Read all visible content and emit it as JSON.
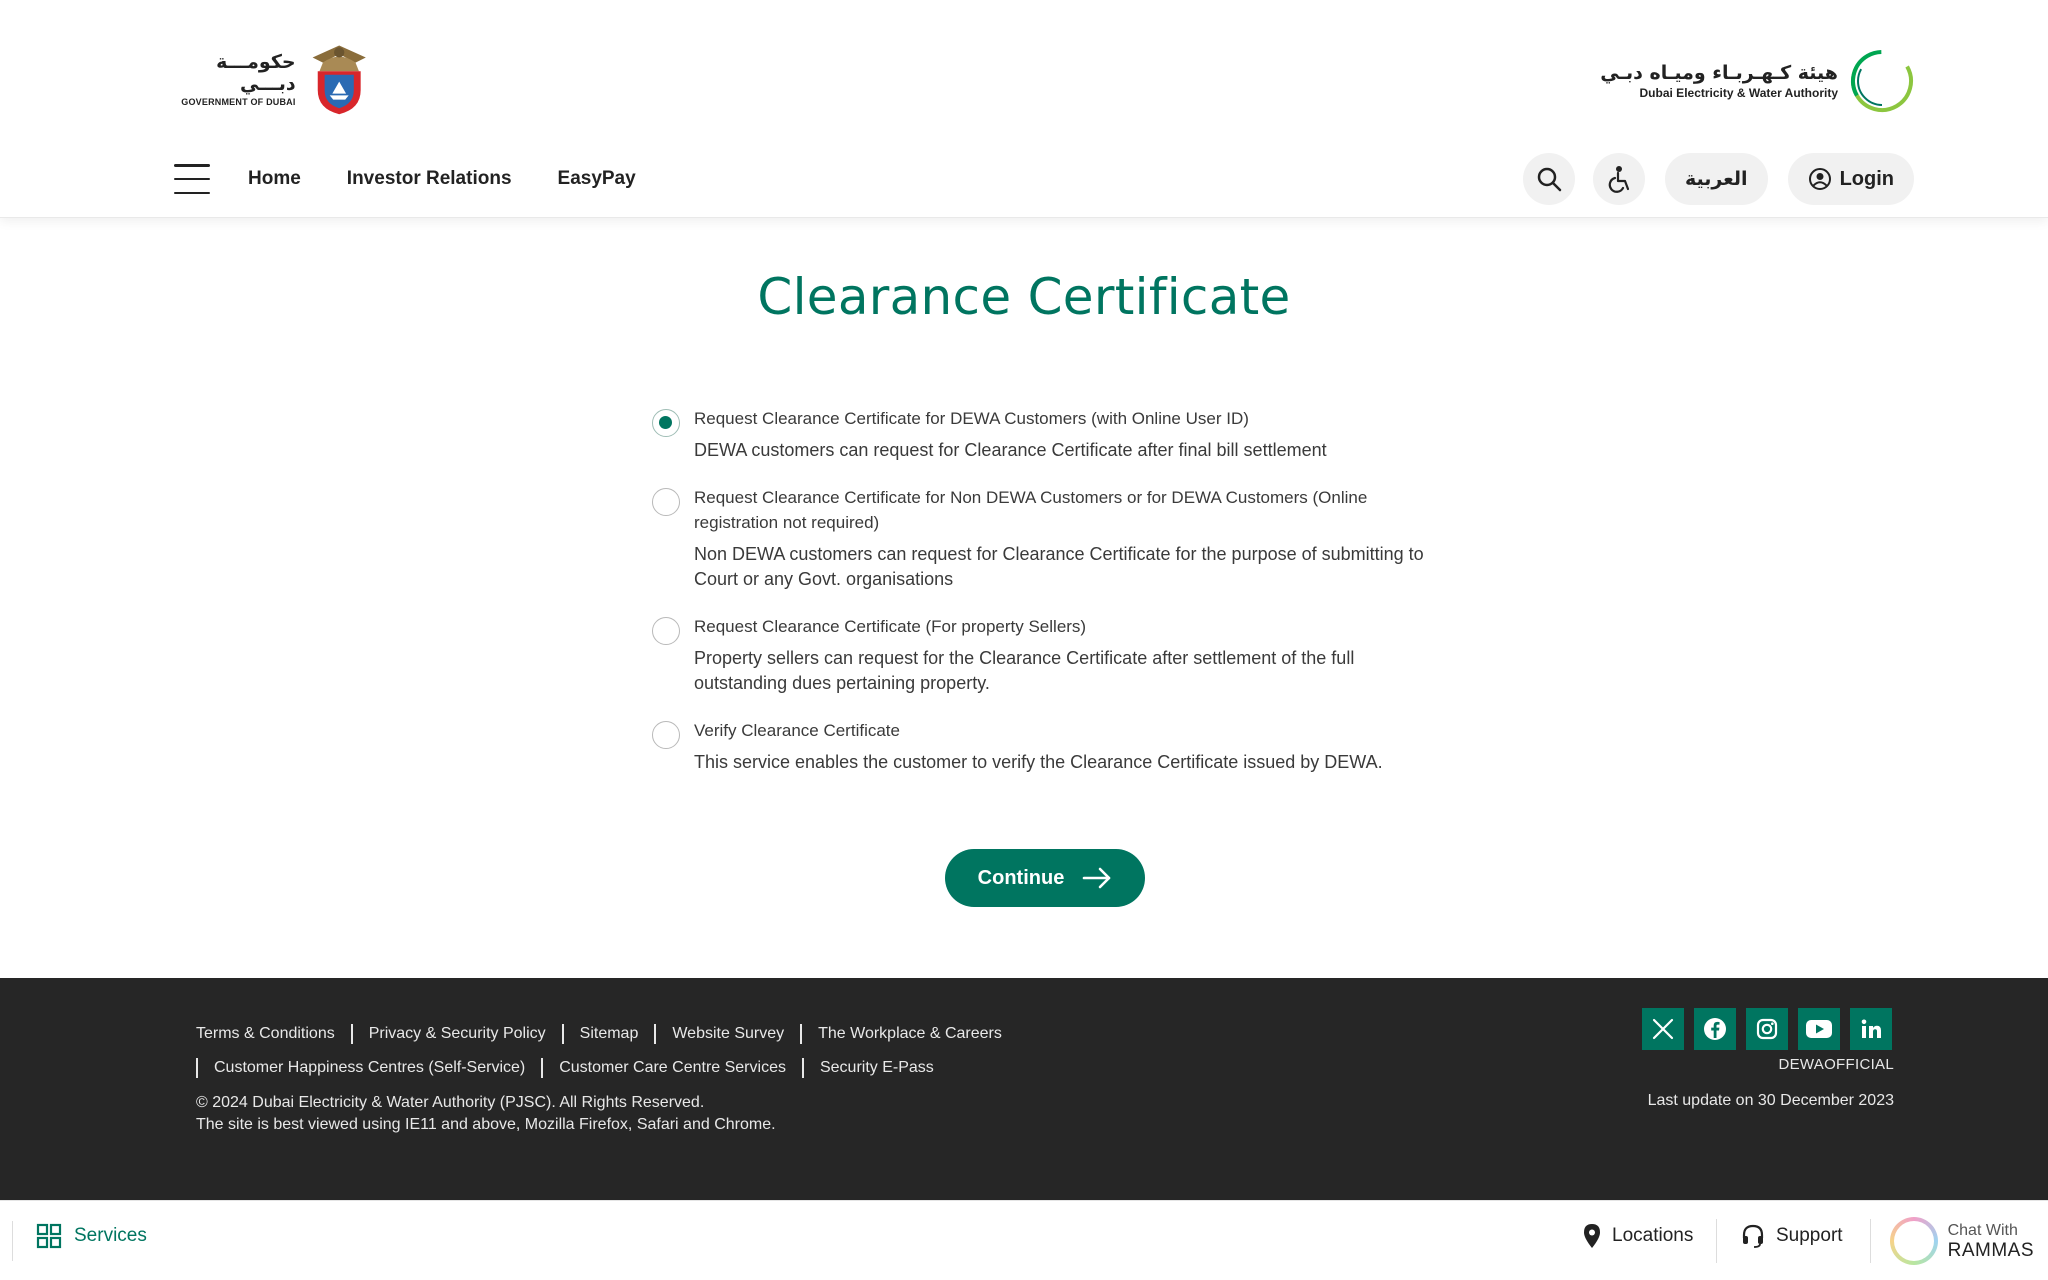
{
  "header": {
    "gov_logo_ar": "حكومـــة دبـــي",
    "gov_logo_en": "GOVERNMENT OF DUBAI",
    "dewa_logo_ar": "هيئة كـهـربـاء وميـاه دبـي",
    "dewa_logo_en": "Dubai Electricity & Water Authority",
    "nav": [
      {
        "label": "Home"
      },
      {
        "label": "Investor Relations"
      },
      {
        "label": "EasyPay"
      }
    ],
    "arabic_label": "العربية",
    "login_label": "Login",
    "icons": {
      "search": "search-icon",
      "accessibility": "accessibility-icon",
      "user": "user-circle-icon",
      "menu": "hamburger-icon"
    }
  },
  "main": {
    "title": "Clearance Certificate",
    "selected_index": 0,
    "options": [
      {
        "label": "Request Clearance Certificate for DEWA Customers (with Online User ID)",
        "description": "DEWA customers can request for Clearance Certificate after final bill settlement",
        "checked": true
      },
      {
        "label": "Request Clearance Certificate for Non DEWA Customers or for DEWA Customers (Online registration not required)",
        "description": "Non DEWA customers can request for Clearance Certificate for the purpose of submitting to Court or any Govt. organisations",
        "checked": false
      },
      {
        "label": "Request Clearance Certificate (For property Sellers)",
        "description": "Property sellers can request for the Clearance Certificate after settlement of the full outstanding dues pertaining property.",
        "checked": false
      },
      {
        "label": "Verify Clearance Certificate",
        "description": "This service enables the customer to verify the Clearance Certificate issued by DEWA.",
        "checked": false
      }
    ],
    "continue_label": "Continue"
  },
  "footer": {
    "links_row1": [
      "Terms & Conditions",
      "Privacy & Security Policy",
      "Sitemap",
      "Website Survey",
      "The Workplace & Careers"
    ],
    "links_row2": [
      "Customer Happiness Centres (Self-Service)",
      "Customer Care Centre Services",
      "Security E-Pass"
    ],
    "copyright": "© 2024 Dubai Electricity & Water Authority (PJSC). All Rights Reserved.",
    "browser_note": "The site is best viewed using IE11 and above, Mozilla Firefox, Safari and Chrome.",
    "social": [
      "x-icon",
      "facebook-icon",
      "instagram-icon",
      "youtube-icon",
      "linkedin-icon"
    ],
    "social_handle": "DEWAOFFICIAL",
    "last_update": "Last update on 30 December 2023"
  },
  "bottom_bar": {
    "services_label": "Services",
    "locations_label": "Locations",
    "support_label": "Support",
    "chat_small": "Chat With",
    "chat_big": "RAMMAS"
  },
  "colors": {
    "brand_green": "#007560",
    "footer_bg": "#262626"
  }
}
